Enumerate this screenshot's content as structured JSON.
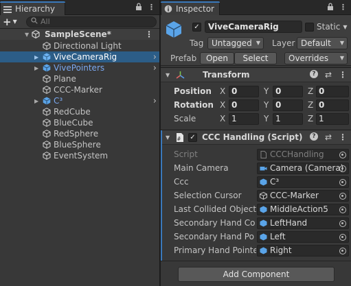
{
  "hierarchy": {
    "tab_label": "Hierarchy",
    "search_placeholder": "All",
    "scene_name": "SampleScene*",
    "items": [
      {
        "label": "Directional Light"
      },
      {
        "label": "ViveCameraRig",
        "selected": true
      },
      {
        "label": "VivePointers"
      },
      {
        "label": "Plane"
      },
      {
        "label": "CCC-Marker"
      },
      {
        "label": "C³"
      },
      {
        "label": "RedCube"
      },
      {
        "label": "BlueCube"
      },
      {
        "label": "RedSphere"
      },
      {
        "label": "BlueSphere"
      },
      {
        "label": "EventSystem"
      }
    ]
  },
  "inspector": {
    "tab_label": "Inspector",
    "object_name": "ViveCameraRig",
    "static_label": "Static",
    "tag_label": "Tag",
    "tag_value": "Untagged",
    "layer_label": "Layer",
    "layer_value": "Default",
    "prefab_label": "Prefab",
    "open_label": "Open",
    "select_label": "Select",
    "overrides_label": "Overrides",
    "transform": {
      "title": "Transform",
      "position_label": "Position",
      "rotation_label": "Rotation",
      "scale_label": "Scale",
      "x": "X",
      "y": "Y",
      "z": "Z",
      "position": [
        "0",
        "0",
        "0"
      ],
      "rotation": [
        "0",
        "0",
        "0"
      ],
      "scale": [
        "1",
        "1",
        "1"
      ]
    },
    "script_component": {
      "title": "CCC Handling (Script)",
      "fields": [
        {
          "label": "Script",
          "value": "CCCHandling"
        },
        {
          "label": "Main Camera",
          "value": "Camera (Camera)"
        },
        {
          "label": "Ccc",
          "value": "C³"
        },
        {
          "label": "Selection Cursor",
          "value": "CCC-Marker"
        },
        {
          "label": "Last Collided Object",
          "value": "MiddleAction5"
        },
        {
          "label": "Secondary Hand Con",
          "value": "LeftHand"
        },
        {
          "label": "Secondary Hand Poir",
          "value": "Left"
        },
        {
          "label": "Primary Hand Pointer",
          "value": "Right"
        }
      ]
    },
    "add_component_label": "Add Component"
  },
  "colors": {
    "selection": "#2c5d87",
    "accent": "#3a79bb",
    "link_blue": "#7aa8f0",
    "cube_blue": "#5aa4e8"
  }
}
